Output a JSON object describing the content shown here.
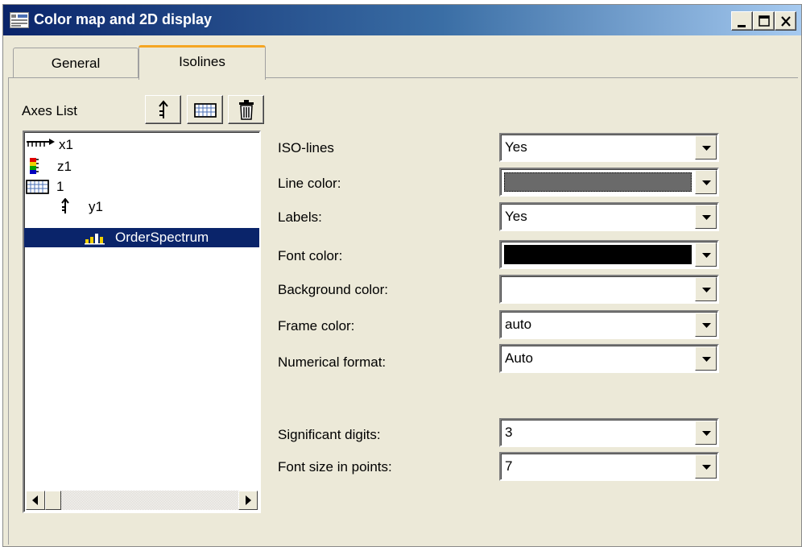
{
  "window": {
    "title": "Color map and 2D display"
  },
  "tabs": [
    {
      "label": "General",
      "active": false
    },
    {
      "label": "Isolines",
      "active": true
    }
  ],
  "axes": {
    "label": "Axes List",
    "toolbar": [
      "axis-up-icon",
      "grid-icon",
      "trash-icon"
    ],
    "tree": [
      {
        "label": "x1",
        "icon": "x-axis-icon",
        "selected": false
      },
      {
        "label": "z1",
        "icon": "color-axis-icon",
        "selected": false
      },
      {
        "label": "1",
        "icon": "grid-icon",
        "selected": false
      },
      {
        "label": "y1",
        "icon": "y-axis-icon",
        "selected": false
      },
      {
        "label": "OrderSpectrum",
        "icon": "bar-chart-icon",
        "selected": true
      }
    ]
  },
  "properties": [
    {
      "label": "ISO-lines",
      "value": "Yes"
    },
    {
      "label": "Line color:",
      "color": "#6a6a6a"
    },
    {
      "label": "Labels:",
      "value": "Yes"
    },
    {
      "label": "Font color:",
      "color": "#000000"
    },
    {
      "label": "Background color:",
      "color": "#ffffff"
    },
    {
      "label": "Frame color:",
      "value": "auto"
    },
    {
      "label": "Numerical format:",
      "value": "Auto"
    },
    {
      "label": "Significant digits:",
      "value": "3"
    },
    {
      "label": "Font size in points:",
      "value": "7"
    }
  ],
  "colors": {
    "title_bar": "#0a246a",
    "selection": "#0a246a",
    "active_tab_accent": "#f5a623",
    "face": "#ece9d8"
  }
}
